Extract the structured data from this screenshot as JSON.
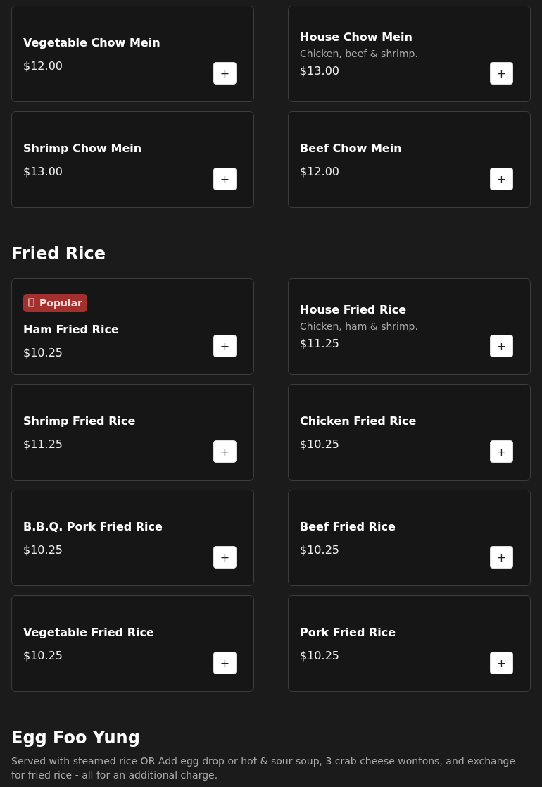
{
  "sections": [
    {
      "items": [
        {
          "name": "Vegetable Chow Mein",
          "price": "$12.00",
          "button": "+"
        },
        {
          "name": "House Chow Mein",
          "description": "Chicken, beef & shrimp.",
          "price": "$13.00",
          "button": "+"
        },
        {
          "name": "Shrimp Chow Mein",
          "price": "$13.00",
          "button": "+"
        },
        {
          "name": "Beef Chow Mein",
          "price": "$12.00",
          "button": "+"
        }
      ]
    },
    {
      "title": "Fried Rice",
      "items": [
        {
          "badge": "Popular",
          "name": "Ham Fried Rice",
          "price": "$10.25",
          "button": "+"
        },
        {
          "name": "House Fried Rice",
          "description": "Chicken, ham & shrimp.",
          "price": "$11.25",
          "button": "+"
        },
        {
          "name": "Shrimp Fried Rice",
          "price": "$11.25",
          "button": "+"
        },
        {
          "name": "Chicken Fried Rice",
          "price": "$10.25",
          "button": "+"
        },
        {
          "name": "B.B.Q. Pork Fried Rice",
          "price": "$10.25",
          "button": "+"
        },
        {
          "name": "Beef Fried Rice",
          "price": "$10.25",
          "button": "+"
        },
        {
          "name": "Vegetable Fried Rice",
          "price": "$10.25",
          "button": "+"
        },
        {
          "name": "Pork Fried Rice",
          "price": "$10.25",
          "button": "+"
        }
      ]
    },
    {
      "title": "Egg Foo Yung",
      "description": "Served with steamed rice OR Add egg drop or hot & sour soup, 3 crab cheese wontons, and exchange for fried rice - all for an additional charge."
    }
  ]
}
